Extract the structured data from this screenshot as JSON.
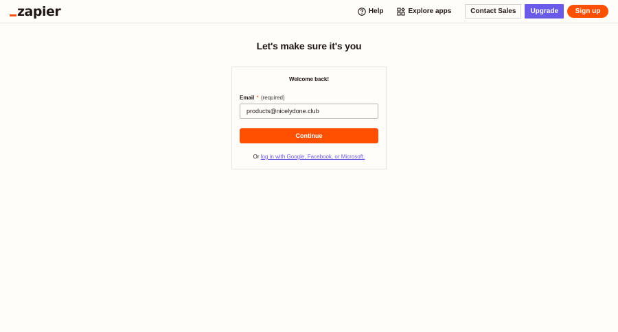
{
  "header": {
    "logo_text": "zapier",
    "help_label": "Help",
    "explore_label": "Explore apps",
    "contact_label": "Contact Sales",
    "upgrade_label": "Upgrade",
    "signup_label": "Sign up"
  },
  "main": {
    "title": "Let's make sure it's you",
    "card": {
      "title": "Welcome back!",
      "email_label": "Email",
      "required_mark": "*",
      "required_hint": "(required)",
      "email_value": "products@nicelydone.club",
      "continue_label": "Continue",
      "alt_prefix": "Or",
      "alt_link": "log in with Google, Facebook, or Microsoft."
    }
  },
  "colors": {
    "brand_orange": "#ff4f00",
    "brand_purple": "#695be8",
    "background": "#fffdf9"
  },
  "icons": [
    "question-circle-icon",
    "apps-grid-icon"
  ]
}
